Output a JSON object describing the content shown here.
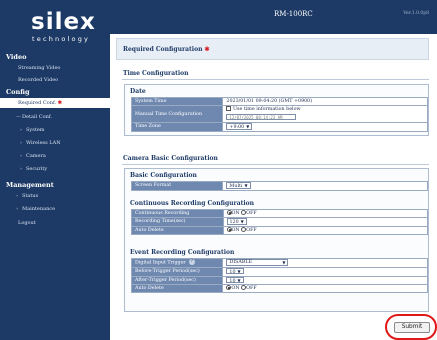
{
  "brand": {
    "logo_main": "silex",
    "logo_sub": "technology"
  },
  "header": {
    "title": "RM-100RC",
    "version": "Ver.1.0.0p8"
  },
  "sidebar": {
    "video_head": "Video",
    "streaming": "Streaming Video",
    "recorded": "Recorded Video",
    "config_head": "Config",
    "required_conf": "Required Conf.",
    "required_star": "✱",
    "detail_conf": "Detail Conf.",
    "system": "System",
    "wireless": "Wireless LAN",
    "camera": "Camera",
    "security": "Security",
    "mgmt_head": "Management",
    "status": "Status",
    "maintenance": "Maintenance",
    "logout": "Logout"
  },
  "main": {
    "banner_title": "Required Configuration",
    "banner_star": "✱",
    "time_section": "Time Configuration",
    "date_box": "Date",
    "system_time_label": "System Time",
    "system_time_value": "2023/01/01 09:04:20 (GMT +0900)",
    "manual_time_label": "Manual Time Configuration",
    "manual_time_check": "Use time information below",
    "manual_time_input": "12/07/2025 08:14:23 AM",
    "time_zone_label": "Time Zone",
    "time_zone_value": "+9:00",
    "camera_section": "Camera Basic Configuration",
    "basic_box": "Basic Configuration",
    "screen_format_label": "Screen Format",
    "screen_format_value": "Multi",
    "cont_box": "Continuous Recording Configuration",
    "cont_rec_label": "Continuous Recording",
    "on": "ON",
    "off": "OFF",
    "rec_time_label": "Recording Time(sec)",
    "rec_time_value": "120",
    "auto_delete_label": "Auto Delete",
    "event_box": "Event Recording Configuration",
    "digital_trigger_label": "Digital Input Trigger",
    "digital_trigger_value": "DISABLE",
    "before_trigger_label": "Before-Trigger Period(sec)",
    "before_trigger_value": "10",
    "after_trigger_label": "After-Trigger Period(sec)",
    "after_trigger_value": "10",
    "auto_delete2_label": "Auto Delete",
    "submit": "Submit"
  },
  "colors": {
    "navy": "#1d3a66",
    "key_cell": "#6f88b0",
    "accent_red": "#e01818"
  }
}
